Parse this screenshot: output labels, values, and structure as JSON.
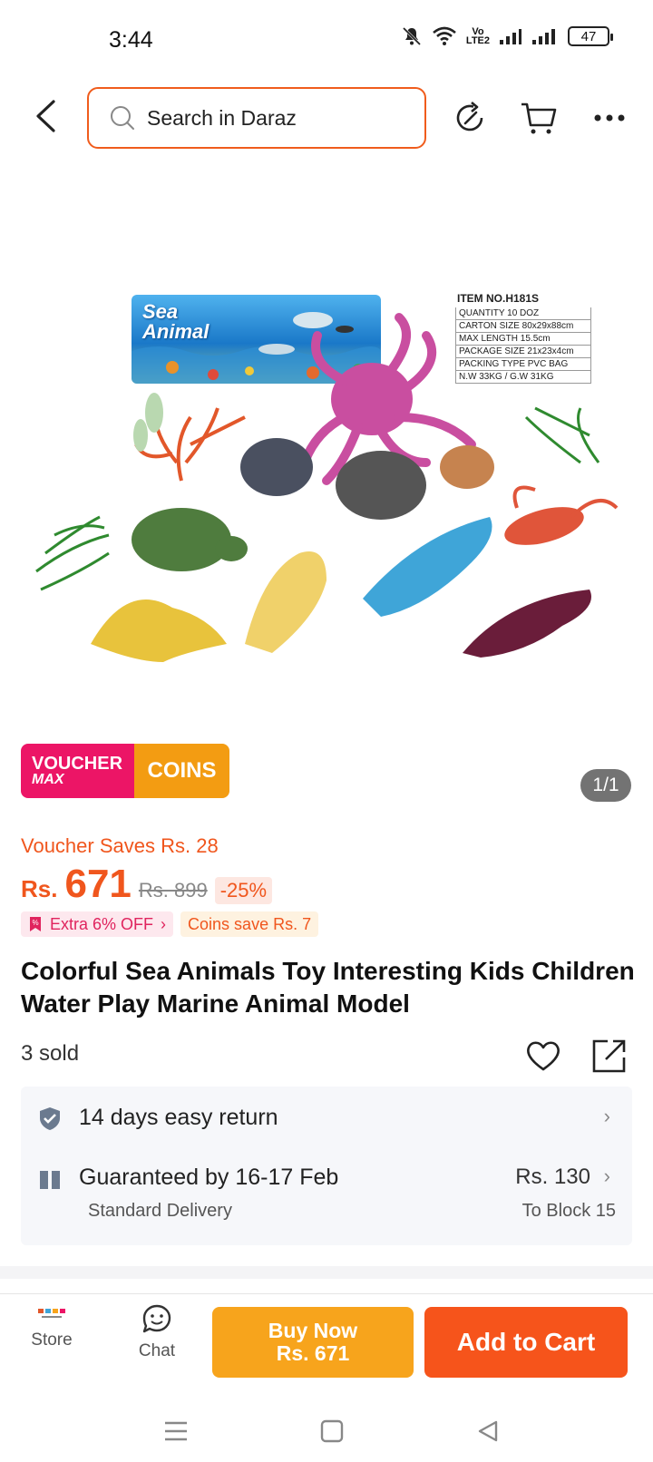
{
  "status_bar": {
    "time": "3:44",
    "volte_line1": "Vo",
    "volte_line2": "LTE2",
    "battery": "47"
  },
  "header": {
    "search_placeholder": "Search in Daraz"
  },
  "product_image": {
    "banner_title_line1": "Sea",
    "banner_title_line2": "Animal",
    "specs_title": "ITEM NO.H181S",
    "specs": [
      "QUANTITY  10 DOZ",
      "CARTON SIZE  80x29x88cm",
      "MAX LENGTH  15.5cm",
      "PACKAGE SIZE  21x23x4cm",
      "PACKING TYPE PVC BAG",
      "N.W  33KG  /  G.W  31KG"
    ]
  },
  "badge": {
    "voucher_line1": "VOUCHER",
    "voucher_line2": "MAX",
    "coins": "COINS"
  },
  "page_indicator": "1/1",
  "pricing": {
    "voucher_saves": "Voucher Saves Rs. 28",
    "currency": "Rs.",
    "price": "671",
    "old_price": "Rs. 899",
    "discount": "-25%",
    "extra_off": "Extra 6% OFF",
    "coins_save": "Coins save Rs. 7"
  },
  "product": {
    "title": "Colorful Sea Animals Toy Interesting Kids Children Water Play Marine Animal Model",
    "sold": "3 sold"
  },
  "services": {
    "return_text": "14 days easy return",
    "delivery_text": "Guaranteed by 16-17 Feb",
    "delivery_sub": "Standard Delivery",
    "delivery_price": "Rs. 130",
    "delivery_location": "To Block 15"
  },
  "bottom_bar": {
    "store_label": "Store",
    "chat_label": "Chat",
    "buy_now_line1": "Buy Now",
    "buy_now_line2": "Rs. 671",
    "add_to_cart": "Add to Cart"
  },
  "colors": {
    "accent_orange": "#f6541b",
    "buy_now_yellow": "#f7a41c",
    "voucher_pink": "#ec1566",
    "coins_amber": "#f39c12"
  }
}
